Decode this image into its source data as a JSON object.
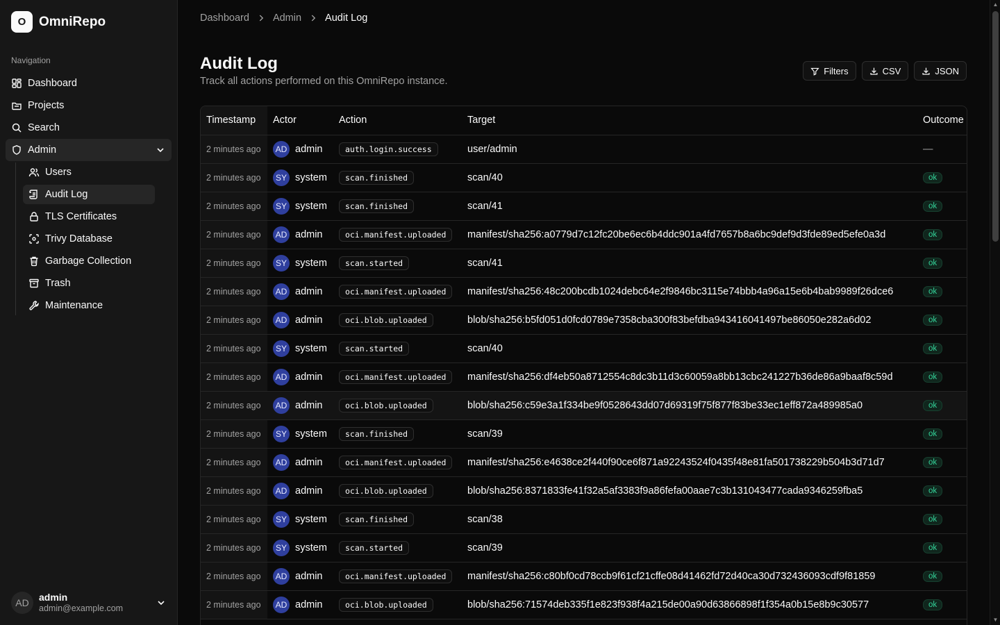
{
  "app": {
    "logo_letter": "O",
    "name": "OmniRepo"
  },
  "sidebar": {
    "group_label": "Navigation",
    "items": [
      {
        "label": "Dashboard",
        "icon": "dashboard-icon"
      },
      {
        "label": "Projects",
        "icon": "folder-icon"
      },
      {
        "label": "Search",
        "icon": "search-icon"
      },
      {
        "label": "Admin",
        "icon": "shield-icon",
        "expanded": true
      }
    ],
    "admin_items": [
      {
        "label": "Users",
        "icon": "users-icon"
      },
      {
        "label": "Audit Log",
        "icon": "scroll-icon",
        "active": true
      },
      {
        "label": "TLS Certificates",
        "icon": "lock-icon"
      },
      {
        "label": "Trivy Database",
        "icon": "scan-icon"
      },
      {
        "label": "Garbage Collection",
        "icon": "trash-can-icon"
      },
      {
        "label": "Trash",
        "icon": "archive-icon"
      },
      {
        "label": "Maintenance",
        "icon": "wrench-icon"
      }
    ],
    "user": {
      "initials": "AD",
      "name": "admin",
      "email": "admin@example.com"
    }
  },
  "breadcrumb": [
    "Dashboard",
    "Admin",
    "Audit Log"
  ],
  "page": {
    "title": "Audit Log",
    "subtitle": "Track all actions performed on this OmniRepo instance."
  },
  "actions": {
    "filters": "Filters",
    "csv": "CSV",
    "json": "JSON"
  },
  "table": {
    "headers": {
      "timestamp": "Timestamp",
      "actor": "Actor",
      "action": "Action",
      "target": "Target",
      "outcome": "Outcome"
    },
    "rows": [
      {
        "ts": "2 minutes ago",
        "initials": "AD",
        "actor": "admin",
        "action": "auth.login.success",
        "target": "user/admin",
        "outcome": "—"
      },
      {
        "ts": "2 minutes ago",
        "initials": "SY",
        "actor": "system",
        "action": "scan.finished",
        "target": "scan/40",
        "outcome": "ok"
      },
      {
        "ts": "2 minutes ago",
        "initials": "SY",
        "actor": "system",
        "action": "scan.finished",
        "target": "scan/41",
        "outcome": "ok"
      },
      {
        "ts": "2 minutes ago",
        "initials": "AD",
        "actor": "admin",
        "action": "oci.manifest.uploaded",
        "target": "manifest/sha256:a0779d7c12fc20be6ec6b4ddc901a4fd7657b8a6bc9def9d3fde89ed5efe0a3d",
        "outcome": "ok"
      },
      {
        "ts": "2 minutes ago",
        "initials": "SY",
        "actor": "system",
        "action": "scan.started",
        "target": "scan/41",
        "outcome": "ok"
      },
      {
        "ts": "2 minutes ago",
        "initials": "AD",
        "actor": "admin",
        "action": "oci.manifest.uploaded",
        "target": "manifest/sha256:48c200bcdb1024debc64e2f9846bc3115e74bbb4a96a15e6b4bab9989f26dce6",
        "outcome": "ok"
      },
      {
        "ts": "2 minutes ago",
        "initials": "AD",
        "actor": "admin",
        "action": "oci.blob.uploaded",
        "target": "blob/sha256:b5fd051d0fcd0789e7358cba300f83befdba943416041497be86050e282a6d02",
        "outcome": "ok"
      },
      {
        "ts": "2 minutes ago",
        "initials": "SY",
        "actor": "system",
        "action": "scan.started",
        "target": "scan/40",
        "outcome": "ok"
      },
      {
        "ts": "2 minutes ago",
        "initials": "AD",
        "actor": "admin",
        "action": "oci.manifest.uploaded",
        "target": "manifest/sha256:df4eb50a8712554c8dc3b11d3c60059a8bb13cbc241227b36de86a9baaf8c59d",
        "outcome": "ok"
      },
      {
        "ts": "2 minutes ago",
        "initials": "AD",
        "actor": "admin",
        "action": "oci.blob.uploaded",
        "target": "blob/sha256:c59e3a1f334be9f0528643dd07d69319f75f877f83be33ec1eff872a489985a0",
        "outcome": "ok",
        "hover": true
      },
      {
        "ts": "2 minutes ago",
        "initials": "SY",
        "actor": "system",
        "action": "scan.finished",
        "target": "scan/39",
        "outcome": "ok"
      },
      {
        "ts": "2 minutes ago",
        "initials": "AD",
        "actor": "admin",
        "action": "oci.manifest.uploaded",
        "target": "manifest/sha256:e4638ce2f440f90ce6f871a92243524f0435f48e81fa501738229b504b3d71d7",
        "outcome": "ok"
      },
      {
        "ts": "2 minutes ago",
        "initials": "AD",
        "actor": "admin",
        "action": "oci.blob.uploaded",
        "target": "blob/sha256:8371833fe41f32a5af3383f9a86fefa00aae7c3b131043477cada9346259fba5",
        "outcome": "ok"
      },
      {
        "ts": "2 minutes ago",
        "initials": "SY",
        "actor": "system",
        "action": "scan.finished",
        "target": "scan/38",
        "outcome": "ok"
      },
      {
        "ts": "2 minutes ago",
        "initials": "SY",
        "actor": "system",
        "action": "scan.started",
        "target": "scan/39",
        "outcome": "ok"
      },
      {
        "ts": "2 minutes ago",
        "initials": "AD",
        "actor": "admin",
        "action": "oci.manifest.uploaded",
        "target": "manifest/sha256:c80bf0cd78ccb9f61cf21cffe08d41462fd72d40ca30d732436093cdf9f81859",
        "outcome": "ok"
      },
      {
        "ts": "2 minutes ago",
        "initials": "AD",
        "actor": "admin",
        "action": "oci.blob.uploaded",
        "target": "blob/sha256:71574deb335f1e823f938f4a215de00a90d63866898f1f354a0b15e8b9c30577",
        "outcome": "ok"
      }
    ]
  },
  "colors": {
    "background": "#0a0a0a",
    "sidebar": "#171717",
    "avatar": "#2f3f9e",
    "ok_text": "#34d399"
  }
}
